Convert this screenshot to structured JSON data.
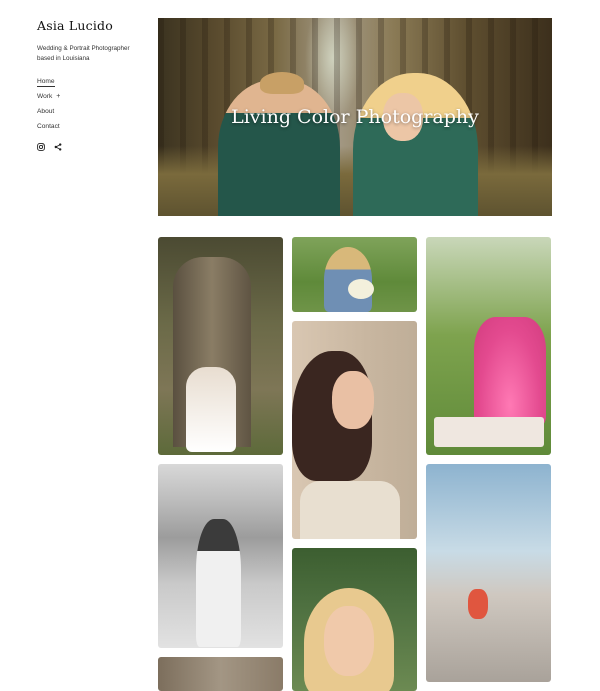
{
  "site": {
    "title": "Asia Lucido",
    "tagline": "Wedding & Portrait Photographer based in Louisiana"
  },
  "nav": {
    "items": [
      {
        "label": "Home",
        "active": true
      },
      {
        "label": "Work",
        "expand": "+"
      },
      {
        "label": "About"
      },
      {
        "label": "Contact"
      }
    ]
  },
  "social": {
    "icons": [
      "instagram-icon",
      "share-icon"
    ]
  },
  "hero": {
    "title": "Living Color Photography"
  },
  "gallery": {
    "photos": [
      "bride-under-oak-tree",
      "portrait-with-bouquet",
      "pink-gown-garden",
      "portrait-updo",
      "beach-portrait-bw",
      "rock-outcrop-landscape",
      "blonde-closeup",
      "interior-photo"
    ]
  },
  "colors": {
    "background": "#ffffff",
    "text": "#222222",
    "hero_text": "#ffffff"
  }
}
